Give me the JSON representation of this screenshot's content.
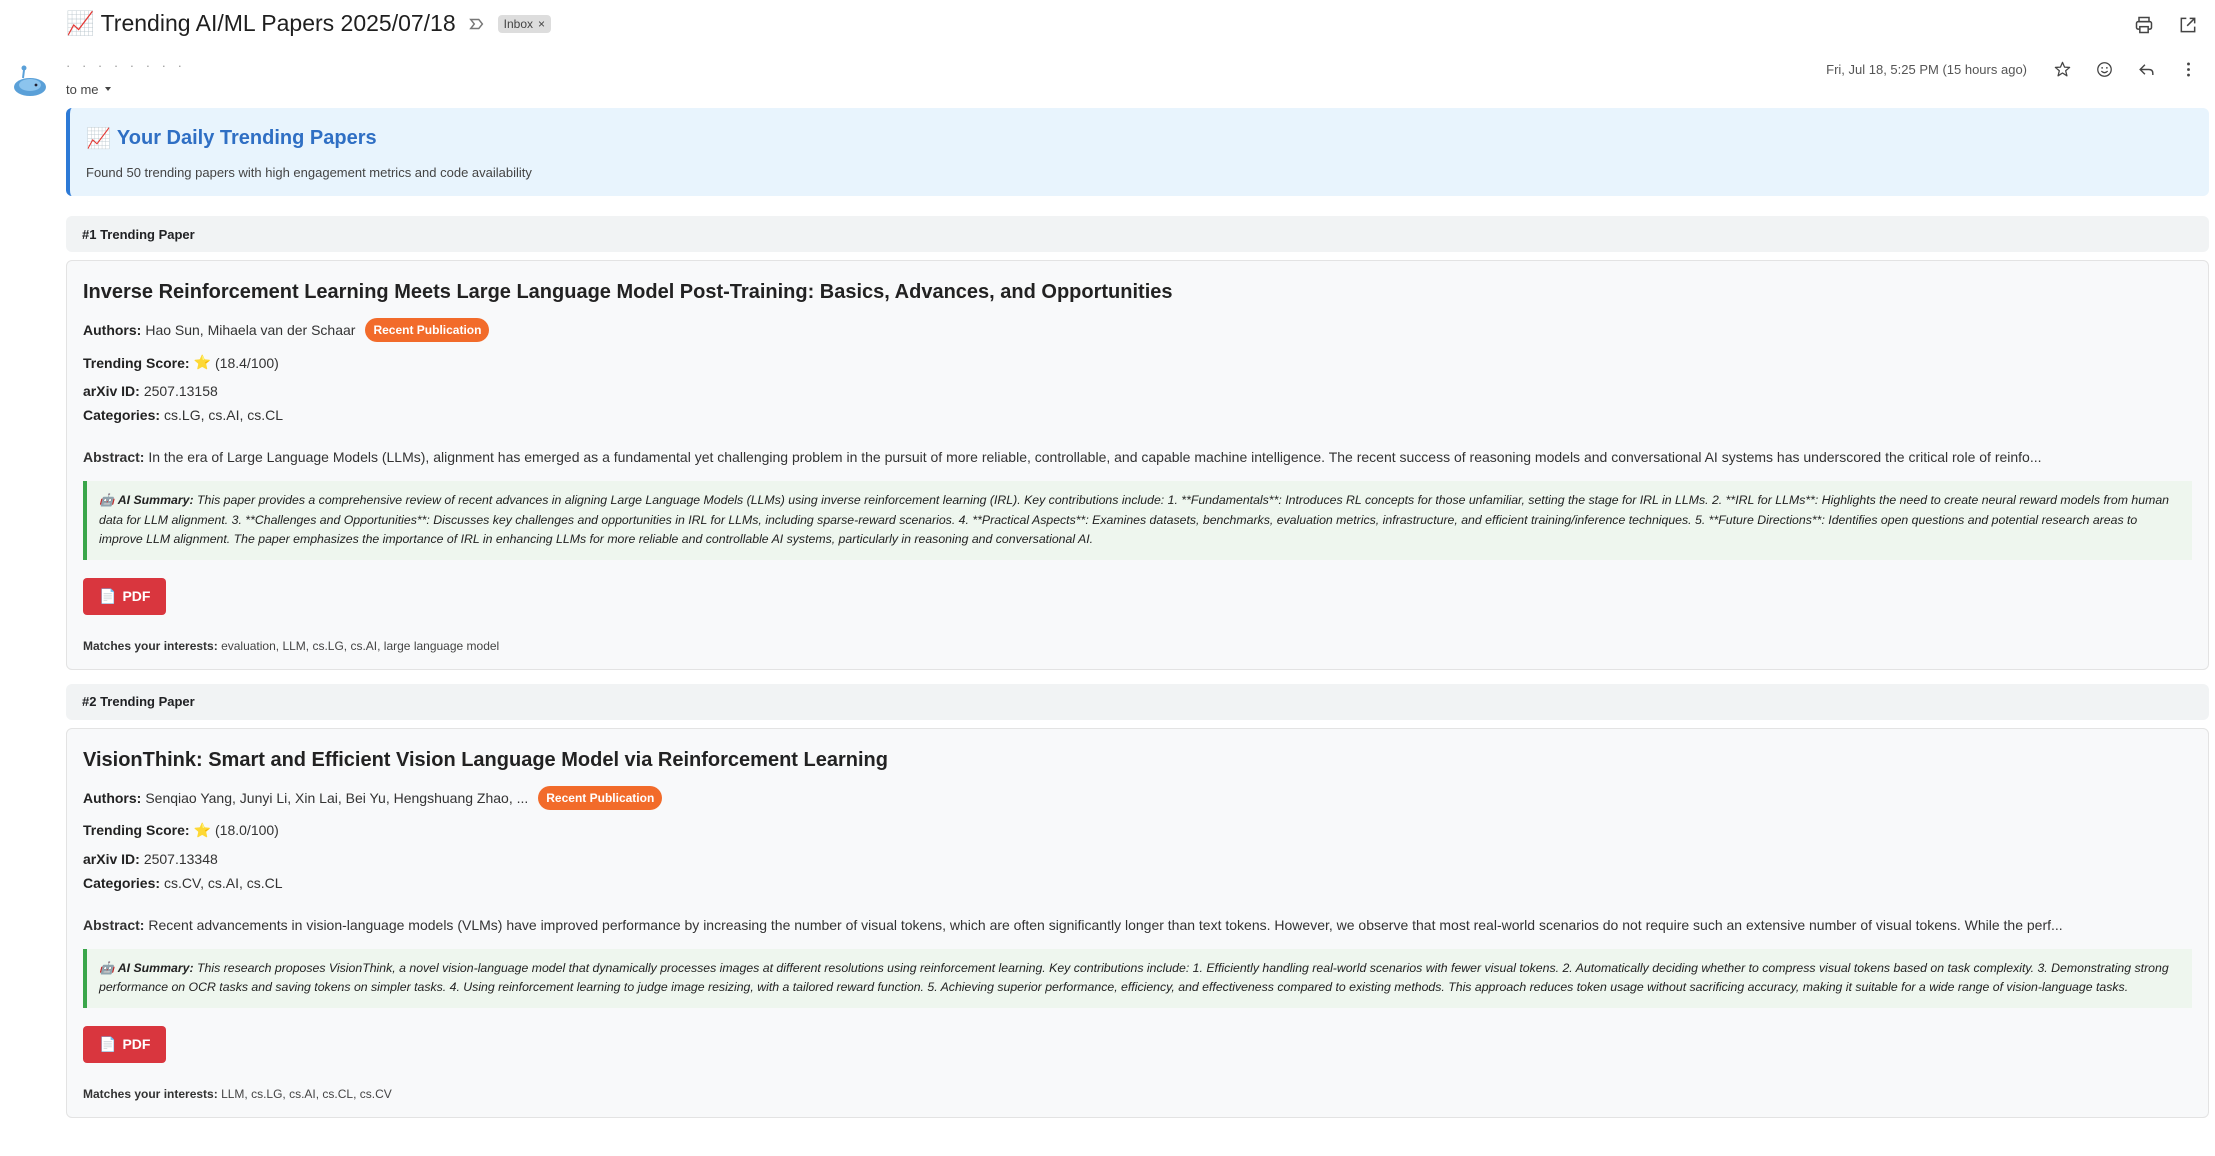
{
  "email": {
    "subject": "📈 Trending AI/ML Papers 2025/07/18",
    "label": "Inbox",
    "label_remove": "×",
    "to_line": "to me",
    "date": "Fri, Jul 18, 5:25 PM (15 hours ago)"
  },
  "banner": {
    "title_icon": "📈",
    "title": "Your Daily Trending Papers",
    "subtitle": "Found 50 trending papers with high engagement metrics and code availability"
  },
  "labels": {
    "authors": "Authors:",
    "trending_score": "Trending Score:",
    "arxiv_id": "arXiv ID:",
    "categories": "Categories:",
    "abstract": "Abstract:",
    "ai_summary": "AI Summary:",
    "pdf_button": "PDF",
    "matches": "Matches your interests:",
    "badge": "Recent Publication"
  },
  "papers": [
    {
      "rank": "#1 Trending Paper",
      "title": "Inverse Reinforcement Learning Meets Large Language Model Post-Training: Basics, Advances, and Opportunities",
      "authors": "Hao Sun, Mihaela van der Schaar",
      "score": "(18.4/100)",
      "arxiv_id": "2507.13158",
      "categories": "cs.LG, cs.AI, cs.CL",
      "abstract": "In the era of Large Language Models (LLMs), alignment has emerged as a fundamental yet challenging problem in the pursuit of more reliable, controllable, and capable machine intelligence. The recent success of reasoning models and conversational AI systems has underscored the critical role of reinfo...",
      "summary": "This paper provides a comprehensive review of recent advances in aligning Large Language Models (LLMs) using inverse reinforcement learning (IRL). Key contributions include: 1. **Fundamentals**: Introduces RL concepts for those unfamiliar, setting the stage for IRL in LLMs. 2. **IRL for LLMs**: Highlights the need to create neural reward models from human data for LLM alignment. 3. **Challenges and Opportunities**: Discusses key challenges and opportunities in IRL for LLMs, including sparse-reward scenarios. 4. **Practical Aspects**: Examines datasets, benchmarks, evaluation metrics, infrastructure, and efficient training/inference techniques. 5. **Future Directions**: Identifies open questions and potential research areas to improve LLM alignment. The paper emphasizes the importance of IRL in enhancing LLMs for more reliable and controllable AI systems, particularly in reasoning and conversational AI.",
      "interests": "evaluation, LLM, cs.LG, cs.AI, large language model"
    },
    {
      "rank": "#2 Trending Paper",
      "title": "VisionThink: Smart and Efficient Vision Language Model via Reinforcement Learning",
      "authors": "Senqiao Yang, Junyi Li, Xin Lai, Bei Yu, Hengshuang Zhao, ...",
      "score": "(18.0/100)",
      "arxiv_id": "2507.13348",
      "categories": "cs.CV, cs.AI, cs.CL",
      "abstract": "Recent advancements in vision-language models (VLMs) have improved performance by increasing the number of visual tokens, which are often significantly longer than text tokens. However, we observe that most real-world scenarios do not require such an extensive number of visual tokens. While the perf...",
      "summary": "This research proposes VisionThink, a novel vision-language model that dynamically processes images at different resolutions using reinforcement learning. Key contributions include: 1. Efficiently handling real-world scenarios with fewer visual tokens. 2. Automatically deciding whether to compress visual tokens based on task complexity. 3. Demonstrating strong performance on OCR tasks and saving tokens on simpler tasks. 4. Using reinforcement learning to judge image resizing, with a tailored reward function. 5. Achieving superior performance, efficiency, and effectiveness compared to existing methods. This approach reduces token usage without sacrificing accuracy, making it suitable for a wide range of vision-language tasks.",
      "interests": "LLM, cs.LG, cs.AI, cs.CL, cs.CV"
    }
  ]
}
